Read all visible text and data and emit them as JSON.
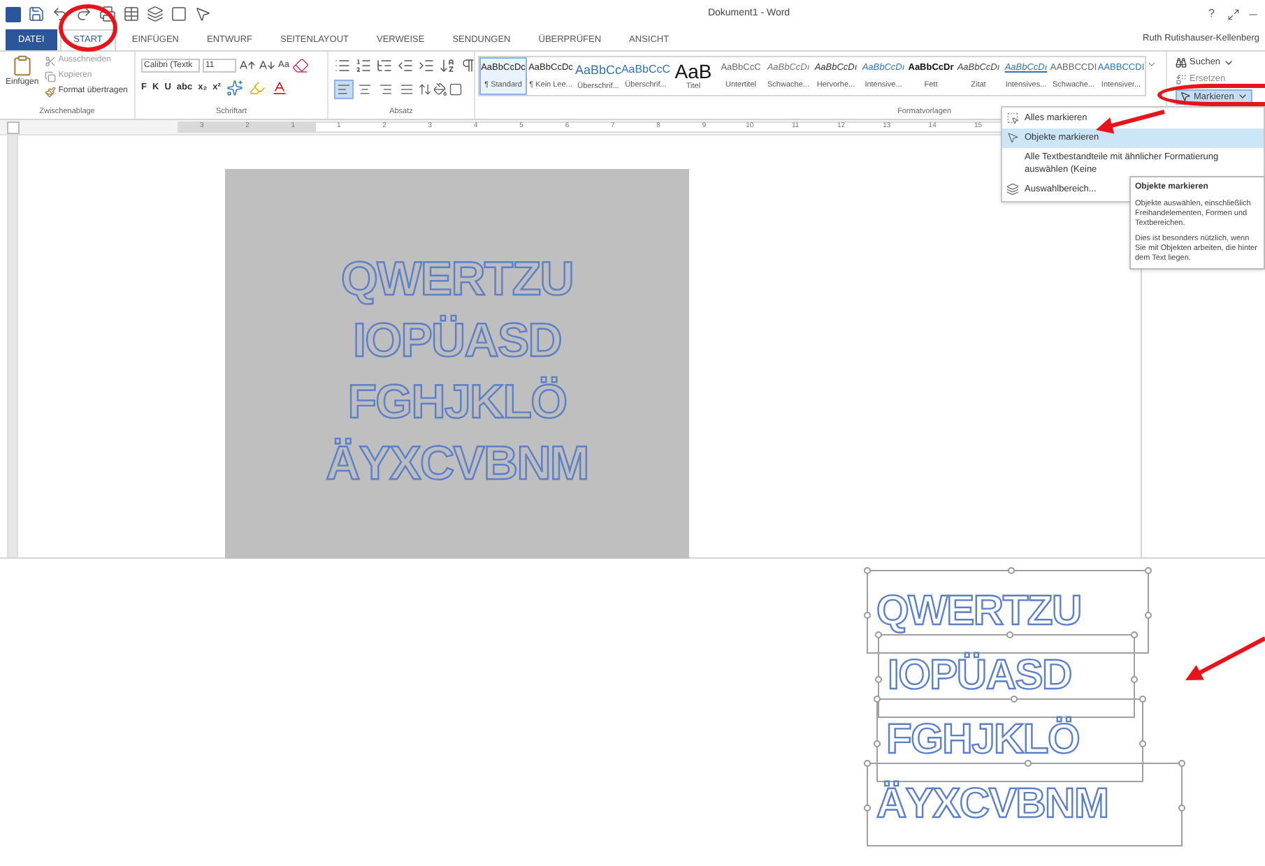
{
  "window": {
    "title": "Dokument1 - Word",
    "help": "?",
    "user": "Ruth Rutishauser-Kellenberg"
  },
  "tabs": [
    {
      "label": "DATEI",
      "kind": "file",
      "selected": false
    },
    {
      "label": "START",
      "kind": "tab",
      "selected": true
    },
    {
      "label": "EINFÜGEN",
      "kind": "tab",
      "selected": false
    },
    {
      "label": "ENTWURF",
      "kind": "tab",
      "selected": false
    },
    {
      "label": "SEITENLAYOUT",
      "kind": "tab",
      "selected": false
    },
    {
      "label": "VERWEISE",
      "kind": "tab",
      "selected": false
    },
    {
      "label": "SENDUNGEN",
      "kind": "tab",
      "selected": false
    },
    {
      "label": "ÜBERPRÜFEN",
      "kind": "tab",
      "selected": false
    },
    {
      "label": "ANSICHT",
      "kind": "tab",
      "selected": false
    }
  ],
  "clipboard": {
    "paste": "Einfügen",
    "cut": "Ausschneiden",
    "copy": "Kopieren",
    "format_painter": "Format übertragen",
    "label": "Zwischenablage"
  },
  "font": {
    "name": "Calibri (Textk",
    "size": "11",
    "case_button": "Aa",
    "format_buttons": [
      "F",
      "K",
      "U",
      "abc",
      "x₂",
      "x²"
    ],
    "label": "Schriftart"
  },
  "paragraph": {
    "label": "Absatz",
    "alignments": [
      {
        "kind": "left",
        "selected": true
      },
      {
        "kind": "center",
        "selected": false
      },
      {
        "kind": "right",
        "selected": false
      },
      {
        "kind": "justify",
        "selected": false
      }
    ]
  },
  "styles": {
    "label": "Formatvorlagen",
    "items": [
      {
        "preview": "AaBbCcDc",
        "label": "¶ Standard",
        "kind": "plain",
        "selected": true
      },
      {
        "preview": "AaBbCcDc",
        "label": "¶ Kein Lee...",
        "kind": "plain",
        "selected": false
      },
      {
        "preview": "AaBbCc",
        "label": "Überschrif...",
        "kind": "heading1",
        "selected": false
      },
      {
        "preview": "AaBbCcC",
        "label": "Überschrif...",
        "kind": "heading2",
        "selected": false
      },
      {
        "preview": "AaB",
        "label": "Titel",
        "kind": "title",
        "selected": false
      },
      {
        "preview": "AaBbCcC",
        "label": "Untertitel",
        "kind": "subtitle",
        "selected": false
      },
      {
        "preview": "AaBbCcDı",
        "label": "Schwache...",
        "kind": "subtle",
        "selected": false
      },
      {
        "preview": "AaBbCcDı",
        "label": "Hervorhe...",
        "kind": "emphasis",
        "selected": false
      },
      {
        "preview": "AaBbCcDı",
        "label": "Intensive...",
        "kind": "intense",
        "selected": false
      },
      {
        "preview": "AaBbCcDr",
        "label": "Fett",
        "kind": "strong",
        "selected": false
      },
      {
        "preview": "AaBbCcDı",
        "label": "Zitat",
        "kind": "quote",
        "selected": false
      },
      {
        "preview": "AaBbCcDı",
        "label": "Intensives...",
        "kind": "intense_quote",
        "selected": false
      },
      {
        "preview": "AABBCCDI",
        "label": "Schwache...",
        "kind": "subtle_ref",
        "selected": false
      },
      {
        "preview": "AABBCCDI",
        "label": "Intensiver...",
        "kind": "intense_ref",
        "selected": false
      }
    ]
  },
  "editing": {
    "find": "Suchen",
    "replace": "Ersetzen",
    "select": "Markieren"
  },
  "ruler": {
    "ticks": [
      "3",
      "2",
      "1",
      "1",
      "2",
      "3",
      "4",
      "5",
      "6",
      "7",
      "8",
      "9",
      "10",
      "11",
      "12",
      "13",
      "14",
      "15"
    ]
  },
  "document": {
    "lines": [
      "QWERTZU",
      "IOPÜASD",
      "FGHJKLÖ",
      "ÄYXCVBNM"
    ]
  },
  "select_menu": {
    "items": [
      {
        "label": "Alles markieren",
        "kind": "all",
        "selected": false
      },
      {
        "label": "Objekte markieren",
        "kind": "objects",
        "selected": true
      },
      {
        "label": "Alle Textbestandteile mit ähnlicher Formatierung auswählen (Keine",
        "kind": "similar",
        "selected": false
      },
      {
        "label": "Auswahlbereich...",
        "kind": "pane",
        "selected": false
      }
    ]
  },
  "tooltip": {
    "title": "Objekte markieren",
    "paragraphs": [
      "Objekte auswählen, einschließlich Freihandelementen, Formen und Textbereichen.",
      "Dies ist besonders nützlich, wenn Sie mit Objekten arbeiten, die hinter dem Text liegen."
    ]
  },
  "selection_example": {
    "lines": [
      "QWERTZU",
      "IOPÜASD",
      "FGHJKLÖ",
      "ÄYXCVBNM"
    ]
  }
}
